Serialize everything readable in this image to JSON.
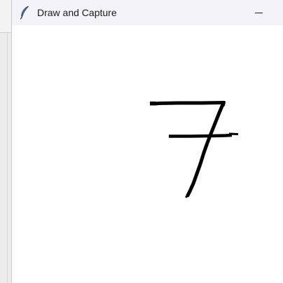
{
  "window": {
    "title": "Draw and Capture",
    "app_icon": "feather-icon",
    "controls": {
      "minimize_icon": "minimize-icon"
    }
  },
  "canvas": {
    "background": "#ffffff",
    "stroke_color": "#000000",
    "drawn_content": "handwritten digit stroke"
  }
}
